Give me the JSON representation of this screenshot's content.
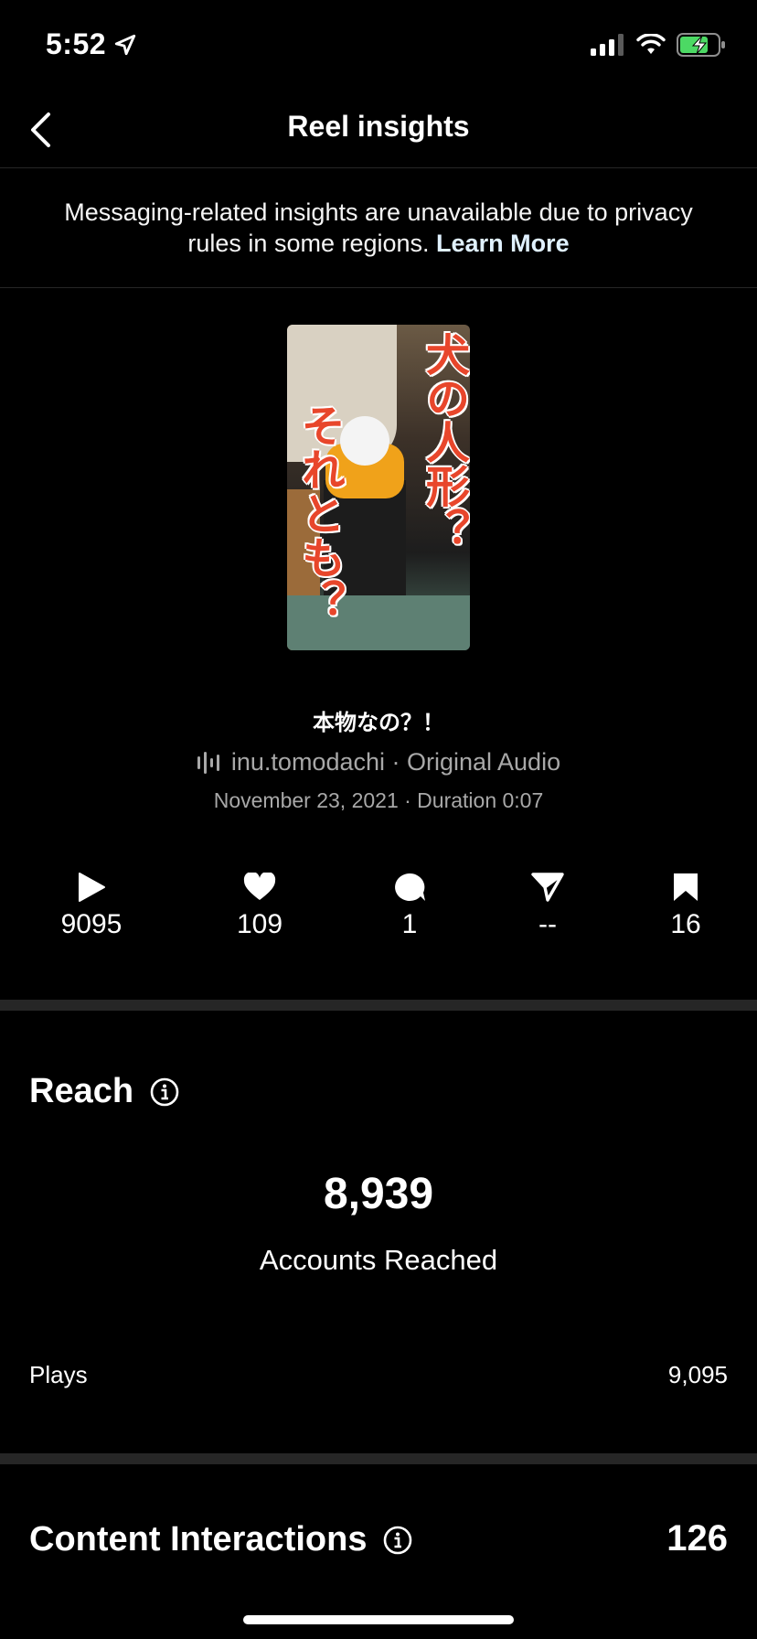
{
  "status_bar": {
    "time": "5:52"
  },
  "header": {
    "title": "Reel insights"
  },
  "notice": {
    "text": "Messaging-related insights are unavailable due to privacy rules in some regions.",
    "link": "Learn More"
  },
  "reel": {
    "thumbnail_caption_1": "犬の人形？",
    "thumbnail_caption_2": "それとも？",
    "title": "本物なの？！",
    "audio": "inu.tomodachi · Original Audio",
    "meta": "November 23, 2021 · Duration 0:07"
  },
  "stats": {
    "plays": "9095",
    "likes": "109",
    "comments": "1",
    "shares": "--",
    "saves": "16"
  },
  "reach": {
    "title": "Reach",
    "accounts_reached_value": "8,939",
    "accounts_reached_label": "Accounts Reached",
    "plays_label": "Plays",
    "plays_value": "9,095"
  },
  "content_interactions": {
    "title": "Content Interactions",
    "value": "126"
  }
}
